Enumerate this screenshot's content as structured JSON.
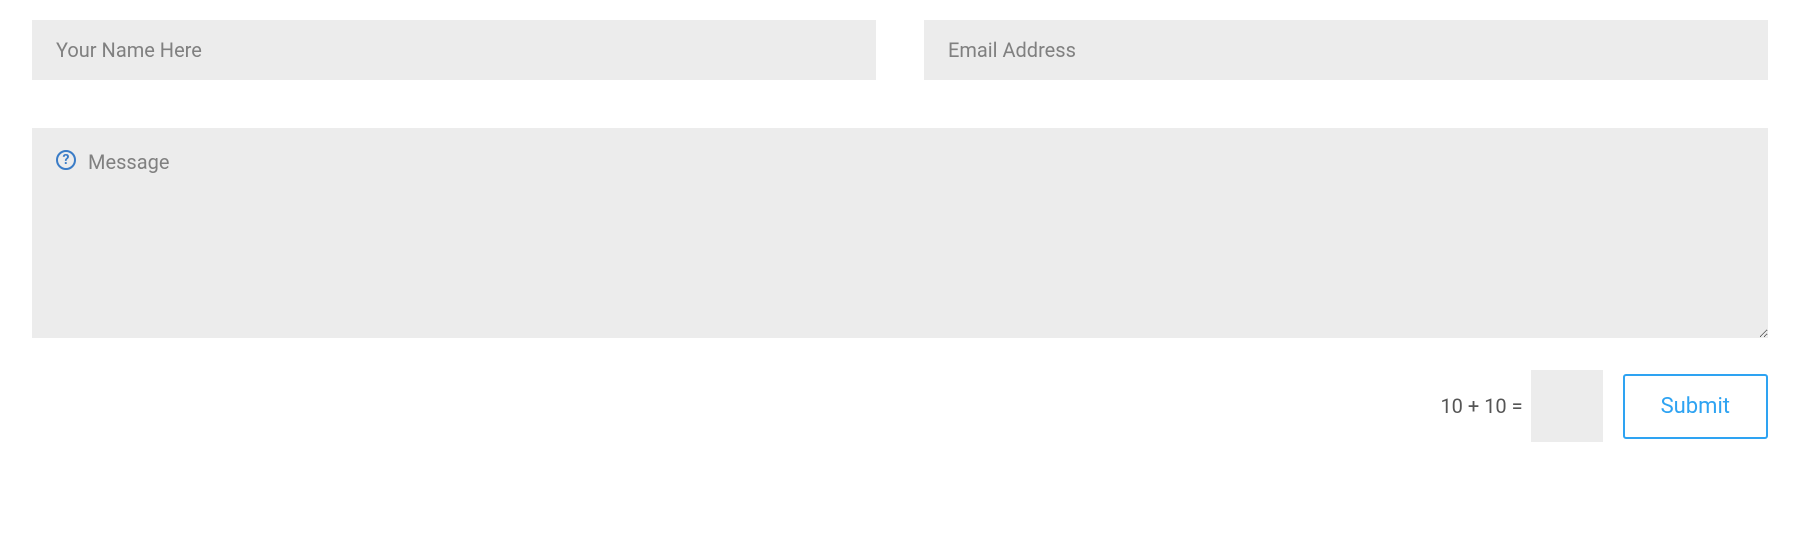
{
  "form": {
    "name_placeholder": "Your Name Here",
    "email_placeholder": "Email Address",
    "message_placeholder": "Message",
    "captcha_question": "10 + 10 =",
    "submit_label": "Submit"
  },
  "colors": {
    "input_bg": "#ececec",
    "accent": "#2ea3f2",
    "icon_blue": "#3a7cc7"
  }
}
